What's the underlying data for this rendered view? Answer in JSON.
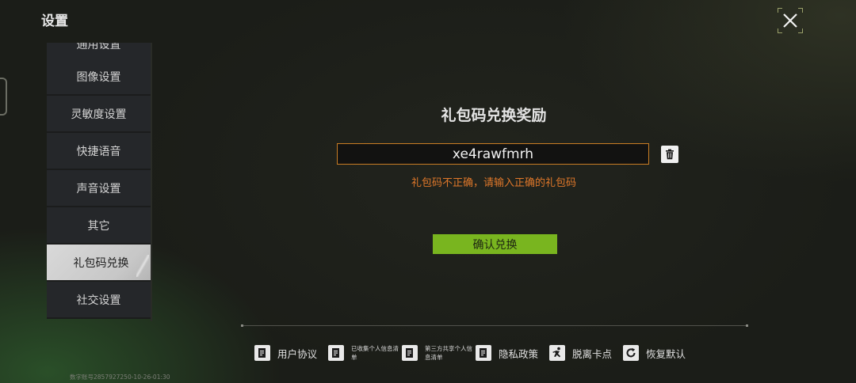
{
  "header": {
    "title": "设置"
  },
  "sidebar": {
    "items": [
      {
        "label": "通用设置",
        "active": false
      },
      {
        "label": "图像设置",
        "active": false
      },
      {
        "label": "灵敏度设置",
        "active": false
      },
      {
        "label": "快捷语音",
        "active": false
      },
      {
        "label": "声音设置",
        "active": false
      },
      {
        "label": "其它",
        "active": false
      },
      {
        "label": "礼包码兑换",
        "active": true
      },
      {
        "label": "社交设置",
        "active": false
      }
    ]
  },
  "redeem": {
    "heading": "礼包码兑换奖励",
    "code_value": "xe4rawfmrh",
    "error": "礼包码不正确，请输入正确的礼包码",
    "confirm_label": "确认兑换"
  },
  "footer": {
    "items": [
      {
        "label": "用户协议",
        "icon": "document-icon"
      },
      {
        "label": "已收集个人信息清单",
        "icon": "document-icon"
      },
      {
        "label": "第三方共享个人信息清单",
        "icon": "document-icon"
      },
      {
        "label": "隐私政策",
        "icon": "document-icon"
      },
      {
        "label": "脱离卡点",
        "icon": "running-figure-icon"
      },
      {
        "label": "恢复默认",
        "icon": "refresh-icon"
      }
    ],
    "build_info": "数字账号2857927250-10-26-01:30"
  },
  "colors": {
    "accent_green": "#79b51f",
    "error_orange": "#e0782a",
    "input_border": "#c97d24"
  }
}
